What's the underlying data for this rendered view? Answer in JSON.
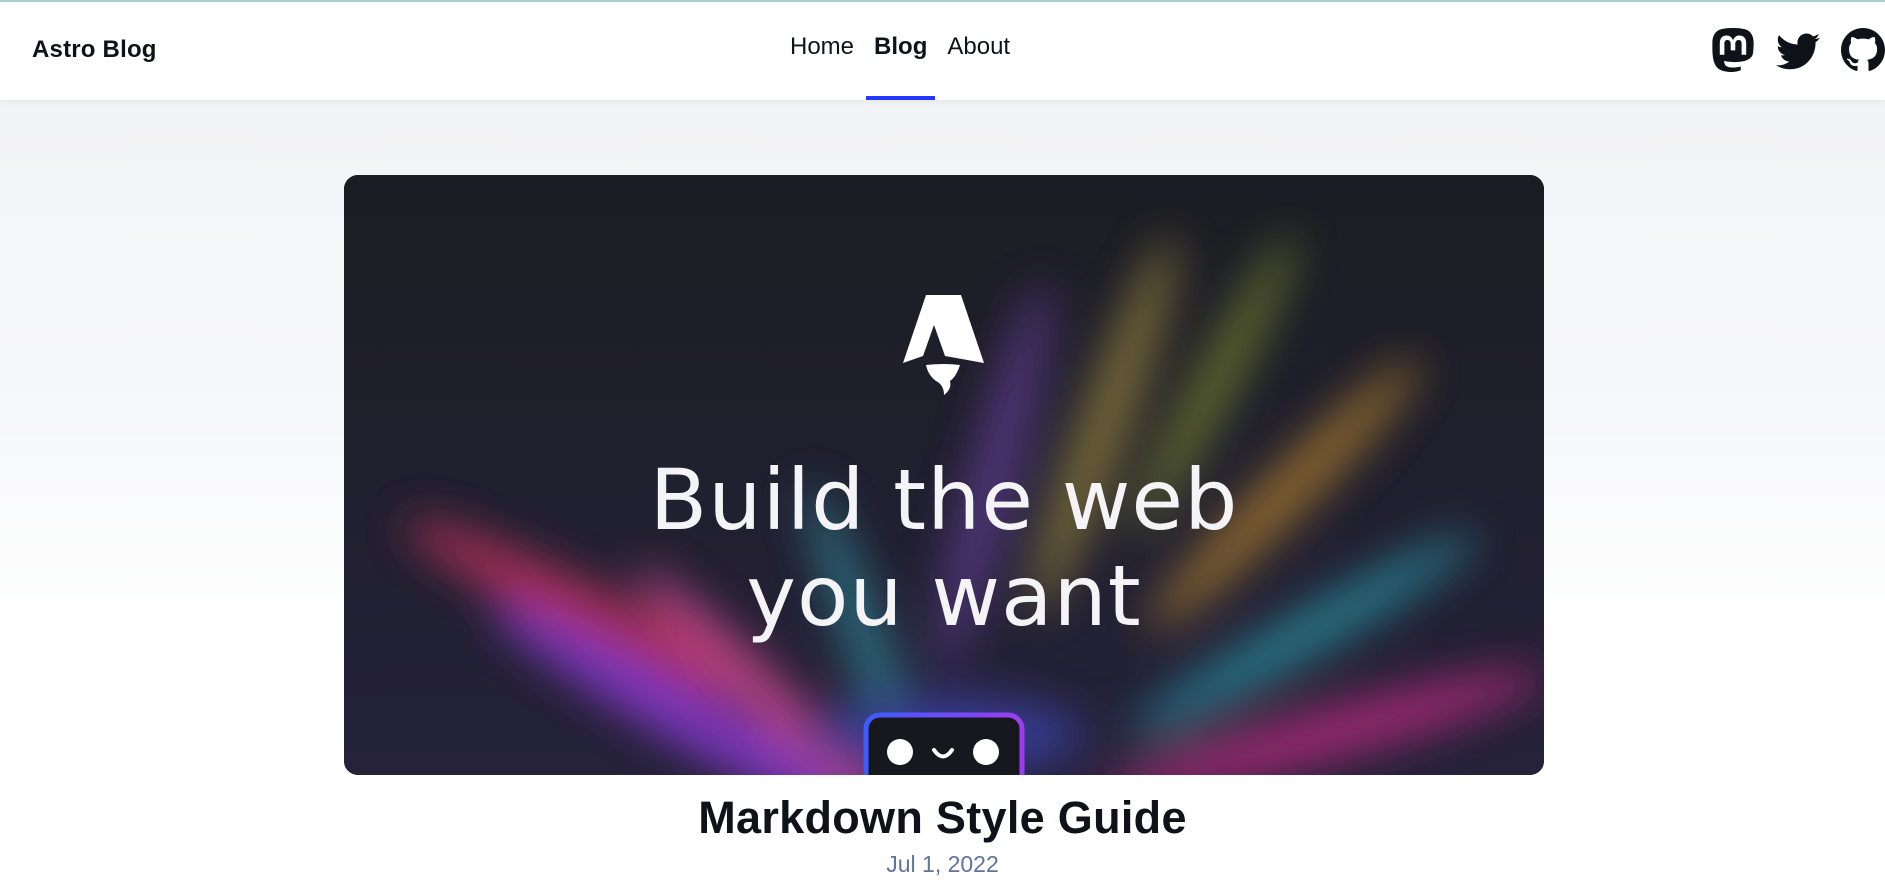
{
  "header": {
    "site_title": "Astro Blog",
    "nav": [
      {
        "label": "Home",
        "active": false
      },
      {
        "label": "Blog",
        "active": true
      },
      {
        "label": "About",
        "active": false
      }
    ],
    "social_links": [
      {
        "icon": "mastodon-icon"
      },
      {
        "icon": "twitter-icon"
      },
      {
        "icon": "github-icon"
      }
    ]
  },
  "hero": {
    "logo_icon": "astro-logo-icon",
    "headline_line1": "Build the web",
    "headline_line2": "you want",
    "mascot_icon": "houston-mascot-icon"
  },
  "post": {
    "title": "Markdown Style Guide",
    "date": "Jul 1, 2022"
  },
  "colors": {
    "accent": "#2337ff",
    "text": "#0f1219",
    "date": "#60739f",
    "hero_bg": "#1b1c24"
  }
}
